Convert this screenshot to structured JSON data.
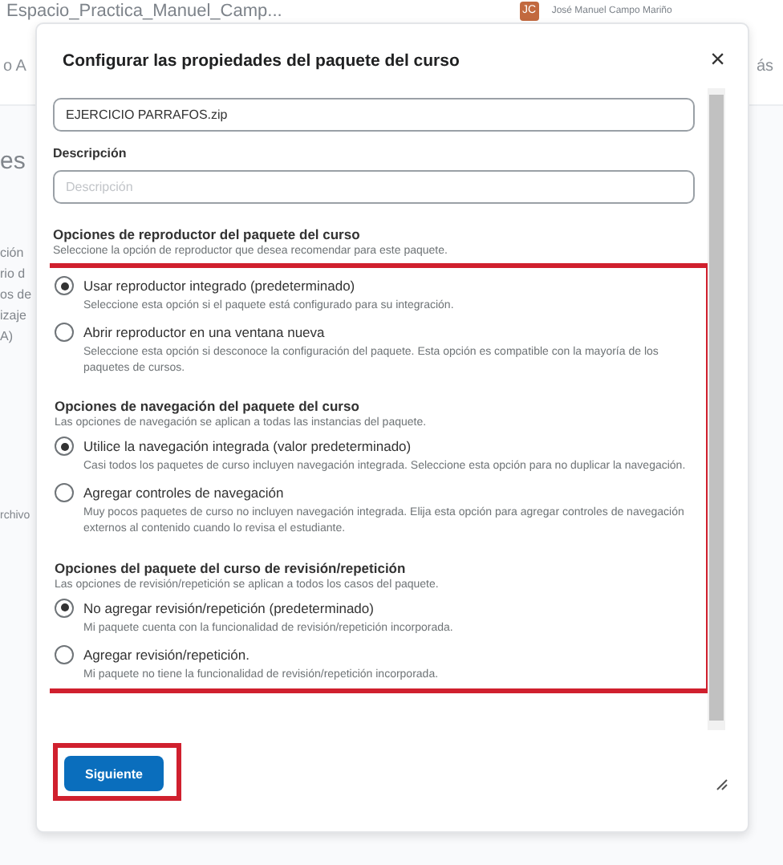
{
  "page": {
    "course_title": "Espacio_Practica_Manuel_Camp...",
    "avatar_initials": "JC",
    "user_name": "José Manuel Campo Mariño",
    "nav_left": "o A",
    "nav_right": "ás",
    "side_fragments": [
      {
        "text": "es",
        "kind": "large"
      },
      {
        "text": "ción",
        "kind": "normal"
      },
      {
        "text": "rio d",
        "kind": "normal"
      },
      {
        "text": "os de",
        "kind": "normal"
      },
      {
        "text": "izaje",
        "kind": "normal"
      },
      {
        "text": "A)",
        "kind": "normal"
      },
      {
        "text": "rchivo",
        "kind": "small"
      }
    ]
  },
  "dialog": {
    "title": "Configurar las propiedades del paquete del curso",
    "close": "×",
    "file_name": "EJERCICIO PARRAFOS.zip",
    "description_label": "Descripción",
    "description_placeholder": "Descripción",
    "options_highlighted": true,
    "sections": [
      {
        "heading": "Opciones de reproductor del paquete del curso",
        "hint": "Seleccione la opción de reproductor que desea recomendar para este paquete.",
        "options": [
          {
            "label": "Usar reproductor integrado (predeterminado)",
            "description": "Seleccione esta opción si el paquete está configurado para su integración.",
            "selected": true
          },
          {
            "label": "Abrir reproductor en una ventana nueva",
            "description": "Seleccione esta opción si desconoce la configuración del paquete. Esta opción es compatible con la mayoría de los paquetes de cursos.",
            "selected": false
          }
        ]
      },
      {
        "heading": "Opciones de navegación del paquete del curso",
        "hint": "Las opciones de navegación se aplican a todas las instancias del paquete.",
        "options": [
          {
            "label": "Utilice la navegación integrada (valor predeterminado)",
            "description": "Casi todos los paquetes de curso incluyen navegación integrada. Seleccione esta opción para no duplicar la navegación.",
            "selected": true
          },
          {
            "label": "Agregar controles de navegación",
            "description": "Muy pocos paquetes de curso no incluyen navegación integrada. Elija esta opción para agregar controles de navegación externos al contenido cuando lo revisa el estudiante.",
            "selected": false
          }
        ]
      },
      {
        "heading": "Opciones del paquete del curso de revisión/repetición",
        "hint": "Las opciones de revisión/repetición se aplican a todos los casos del paquete.",
        "options": [
          {
            "label": "No agregar revisión/repetición (predeterminado)",
            "description": "Mi paquete cuenta con la funcionalidad de revisión/repetición incorporada.",
            "selected": true
          },
          {
            "label": "Agregar revisión/repetición.",
            "description": "Mi paquete no tiene la funcionalidad de revisión/repetición incorporada.",
            "selected": false
          }
        ]
      }
    ],
    "primary_button": "Siguiente",
    "button_highlighted": true
  }
}
